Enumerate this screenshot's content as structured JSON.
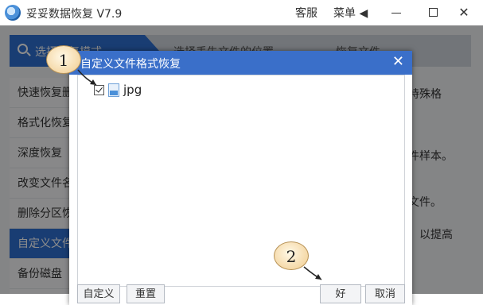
{
  "titlebar": {
    "title": "妥妥数据恢复 V7.9",
    "customer_service": "客服",
    "menu": "菜单 ◀",
    "minimize_glyph": "",
    "close_glyph": "✕"
  },
  "steps": [
    {
      "label": "选择恢复模式"
    },
    {
      "label": "选择丢失文件的位置"
    },
    {
      "label": "恢复文件"
    }
  ],
  "sidebar": {
    "items": [
      {
        "label": "快速恢复删除的文件"
      },
      {
        "label": "格式化恢复"
      },
      {
        "label": "深度恢复"
      },
      {
        "label": "改变文件名"
      },
      {
        "label": "删除分区恢复"
      },
      {
        "label": "自定义文件格式恢复"
      },
      {
        "label": "备份磁盘"
      }
    ]
  },
  "right_panel": {
    "lines": [
      "特殊格",
      "件样本。",
      "。",
      "文件。",
      "，以提高"
    ]
  },
  "dialog": {
    "title": "自定义文件格式恢复",
    "close_glyph": "✕",
    "file_types": [
      {
        "label": "jpg",
        "checked": true
      }
    ],
    "buttons": {
      "custom": "自定义",
      "reset": "重置",
      "ok": "好",
      "cancel": "取消"
    }
  },
  "annotations": {
    "one": "1",
    "two": "2"
  },
  "colors": {
    "accent": "#2f6fd1",
    "dialog_title": "#3a6fc9",
    "callout_fill": "#f5d9a8"
  },
  "icons": {
    "app": "app-logo-icon",
    "search": "search-icon",
    "file": "image-file-icon",
    "check": "checkbox-icon"
  }
}
